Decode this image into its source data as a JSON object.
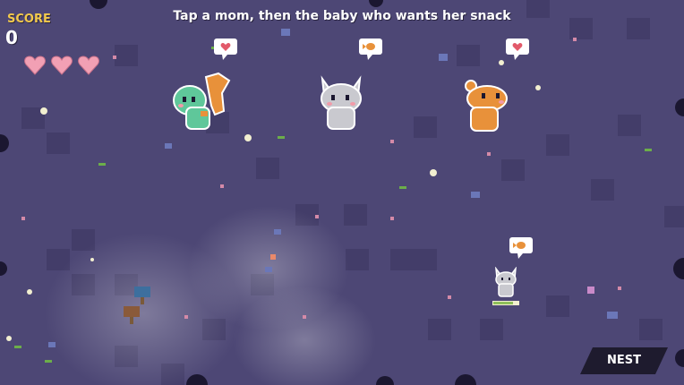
{
  "hud": {
    "score_label": "SCORE",
    "score": "0",
    "lives": 3
  },
  "instruction": "Tap a mom, then the baby who wants her snack",
  "moms": [
    {
      "creature": "green dinosaur",
      "wants": "heart-icon",
      "color": "#5fc79a"
    },
    {
      "creature": "gray cat",
      "wants": "fish-icon",
      "color": "#c9c9cf"
    },
    {
      "creature": "orange bear",
      "wants": "heart-icon",
      "color": "#e8913a"
    }
  ],
  "babies": [
    {
      "creature": "gray kitten",
      "wants": "fish-icon"
    }
  ],
  "buttons": {
    "nest": "NEST"
  },
  "colors": {
    "background": "#4d4775",
    "heart": "#f2a0b4",
    "score_label": "#f2c94c",
    "button": "#1e1b2e"
  }
}
